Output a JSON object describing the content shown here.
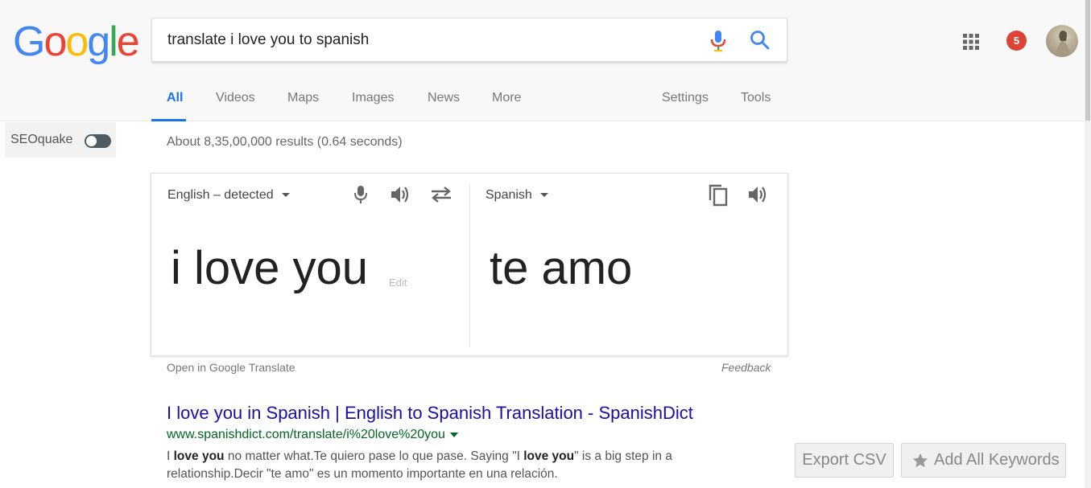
{
  "header": {
    "logo_letters": [
      "G",
      "o",
      "o",
      "g",
      "l",
      "e"
    ],
    "logo_colors": [
      "#4285F4",
      "#EA4335",
      "#FBBC05",
      "#4285F4",
      "#34A853",
      "#EA4335"
    ],
    "search_value": "translate i love you to spanish",
    "notification_count": "5"
  },
  "tabs": {
    "all": "All",
    "videos": "Videos",
    "maps": "Maps",
    "images": "Images",
    "news": "News",
    "more": "More",
    "settings": "Settings",
    "tools": "Tools"
  },
  "seoquake": {
    "label": "SEOquake",
    "toggle_on": false
  },
  "stats": "About 8,35,00,000 results (0.64 seconds)",
  "translate": {
    "source_lang": "English – detected",
    "target_lang": "Spanish",
    "source_text": "i love you",
    "edit_label": "Edit",
    "target_text": "te amo",
    "open_link": "Open in Google Translate",
    "feedback": "Feedback"
  },
  "result": {
    "title": "I love you in Spanish | English to Spanish Translation - SpanishDict",
    "url": "www.spanishdict.com/translate/i%20love%20you",
    "snippet_parts": [
      {
        "text": "I ",
        "bold": false
      },
      {
        "text": "love you",
        "bold": true
      },
      {
        "text": " no matter what.Te quiero pase lo que pase. Saying \"I ",
        "bold": false
      },
      {
        "text": "love you",
        "bold": true
      },
      {
        "text": "\" is a big step in a relationship.Decir \"te amo\" es un momento importante en una relación.",
        "bold": false
      }
    ]
  },
  "buttons": {
    "export_csv": "Export CSV",
    "add_all_keywords": "Add All Keywords"
  },
  "icons": {
    "mic": "mic-icon",
    "search": "search-icon",
    "apps": "apps-grid-icon",
    "speaker": "speaker-icon",
    "swap": "swap-icon",
    "copy": "copy-icon",
    "star": "star-icon"
  }
}
